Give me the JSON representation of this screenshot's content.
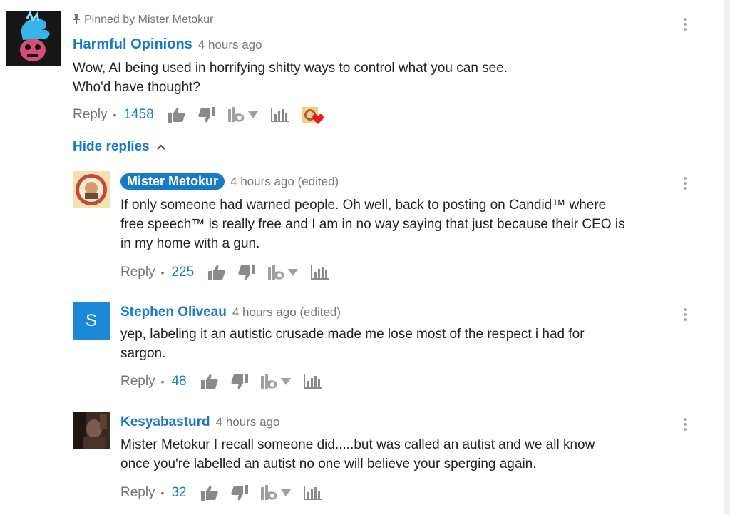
{
  "comments": [
    {
      "pinned_label": "Pinned by Mister Metokur",
      "author": "Harmful Opinions",
      "time": "4 hours ago",
      "lines": [
        "Wow, AI being used in horrifying shitty ways to control what you can see.",
        "Who'd have thought?"
      ],
      "reply_label": "Reply",
      "likes": "1458"
    },
    {
      "author": "Mister Metokur",
      "time": "4 hours ago (edited)",
      "lines": [
        "If only someone had warned people.  Oh well, back to posting on Candid™ where",
        "free speech™ is really free and I am in no way saying that just because their CEO is",
        "in my home with a gun."
      ],
      "reply_label": "Reply",
      "likes": "225"
    },
    {
      "author": "Stephen Oliveau",
      "avatar_letter": "S",
      "time": "4 hours ago (edited)",
      "lines": [
        "yep, labeling it an autistic crusade made me lose most of the respect i had for",
        "sargon."
      ],
      "reply_label": "Reply",
      "likes": "48"
    },
    {
      "author": "Kesyabasturd",
      "time": "4 hours ago",
      "lines": [
        "Mister Metokur I recall someone did.....but was called an autist and we all know",
        "once you're labelled an autist no one will believe your sperging again."
      ],
      "reply_label": "Reply",
      "likes": "32"
    }
  ],
  "hide_replies_label": "Hide replies",
  "icons": [
    "pin-icon",
    "thumbs-up-icon",
    "thumbs-down-icon",
    "tip-icon",
    "dropdown-arrow-icon",
    "stats-icon",
    "creator-heart-icon",
    "chevron-up-icon",
    "more-options-icon"
  ],
  "colors": {
    "link": "#167ac6",
    "muted": "#767676",
    "heart": "#e02020"
  }
}
